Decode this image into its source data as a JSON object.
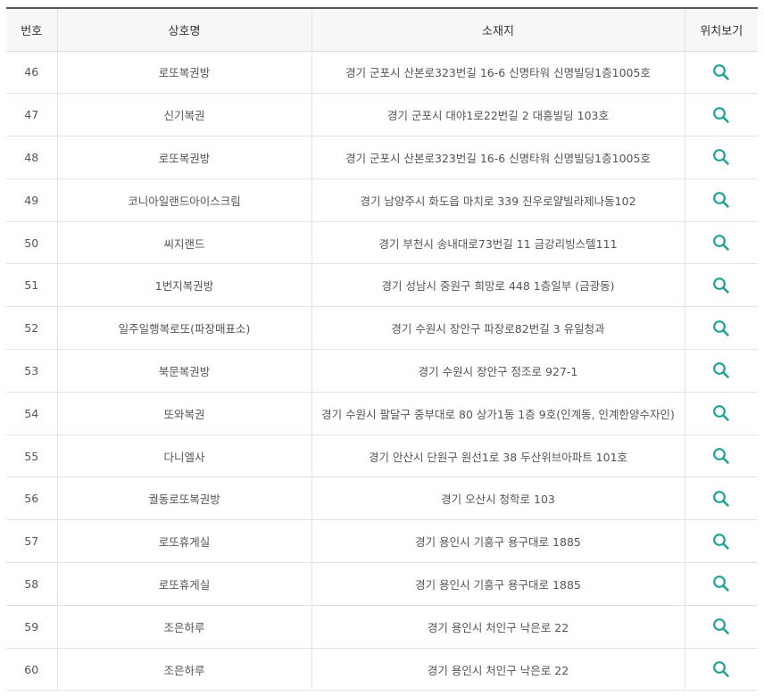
{
  "accent_color": "#1fa294",
  "headers": {
    "no": "번호",
    "name": "상호명",
    "address": "소재지",
    "map": "위치보기"
  },
  "map_icon": "search-icon",
  "rows": [
    {
      "no": "46",
      "name": "로또복권방",
      "address": "경기 군포시 산본로323번길 16-6 신명타워 신명빌딩1층1005호"
    },
    {
      "no": "47",
      "name": "신기복권",
      "address": "경기 군포시 대야1로22번길 2 대흥빌딩 103호"
    },
    {
      "no": "48",
      "name": "로또복권방",
      "address": "경기 군포시 산본로323번길 16-6 신명타워 신명빌딩1층1005호"
    },
    {
      "no": "49",
      "name": "코니아일랜드아이스크림",
      "address": "경기 남양주시 화도읍 마치로 339 진우로얄빌라제나동102"
    },
    {
      "no": "50",
      "name": "씨지랜드",
      "address": "경기 부천시 송내대로73번길 11 금강리빙스텔111"
    },
    {
      "no": "51",
      "name": "1번지복권방",
      "address": "경기 성남시 중원구 희망로 448 1층일부 (금광동)"
    },
    {
      "no": "52",
      "name": "일주일행복로또(파장매표소)",
      "address": "경기 수원시 장안구 파장로82번길 3 유일청과"
    },
    {
      "no": "53",
      "name": "북문복권방",
      "address": "경기 수원시 장안구 정조로 927-1"
    },
    {
      "no": "54",
      "name": "또와복권",
      "address": "경기 수원시 팔달구 중부대로 80 상가1동 1층 9호(인계동, 인계한양수자인)"
    },
    {
      "no": "55",
      "name": "다니엘사",
      "address": "경기 안산시 단원구 원선1로 38 두산위브아파트 101호"
    },
    {
      "no": "56",
      "name": "궐동로또복권방",
      "address": "경기 오산시 청학로 103"
    },
    {
      "no": "57",
      "name": "로또휴게실",
      "address": "경기 용인시 기흥구 용구대로 1885"
    },
    {
      "no": "58",
      "name": "로또휴게실",
      "address": "경기 용인시 기흥구 용구대로 1885"
    },
    {
      "no": "59",
      "name": "조은하루",
      "address": "경기 용인시 처인구 낙은로 22"
    },
    {
      "no": "60",
      "name": "조은하루",
      "address": "경기 용인시 처인구 낙은로 22"
    }
  ]
}
